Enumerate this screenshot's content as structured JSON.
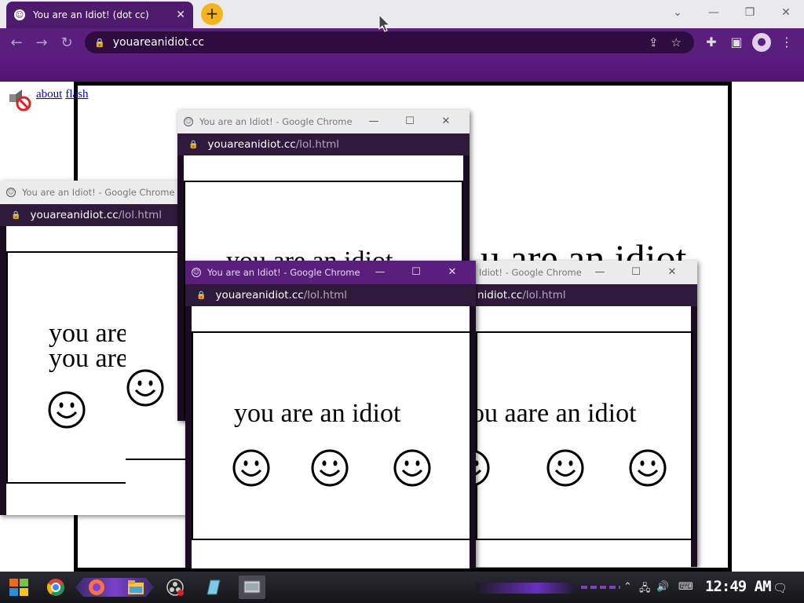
{
  "browser": {
    "tab_title": "You are an Idiot! (dot cc)",
    "tab_close": "✕",
    "new_tab": "+",
    "url": "youareanidiot.cc",
    "win_down": "⌄",
    "win_min": "—",
    "win_restore": "❐",
    "win_close": "✕"
  },
  "page": {
    "link_about": "about",
    "link_flash": "flash",
    "big_text": "u are an idiot"
  },
  "popup": {
    "title": "You are an Idiot! - Google Chrome",
    "title_partial": "Idiot! - Google Chrome",
    "domain": "youareanidiot.cc",
    "domain_partial": "nidiot.cc",
    "path": "/lol.html",
    "min": "—",
    "max": "☐",
    "close": "✕",
    "smiley_icon": "☺"
  },
  "popup_texts": {
    "left_line1": "you are an",
    "left_line2": "you are",
    "center": "you are an idiot",
    "right": "ou aare an idiot",
    "back_top": "you are an idiot"
  },
  "taskbar": {
    "clock": "12:49 AM"
  },
  "colors": {
    "chrome_purple": "#5a1f7d",
    "url_bar_dark": "#2e1a3a",
    "new_tab_yellow": "#f2b51b"
  }
}
